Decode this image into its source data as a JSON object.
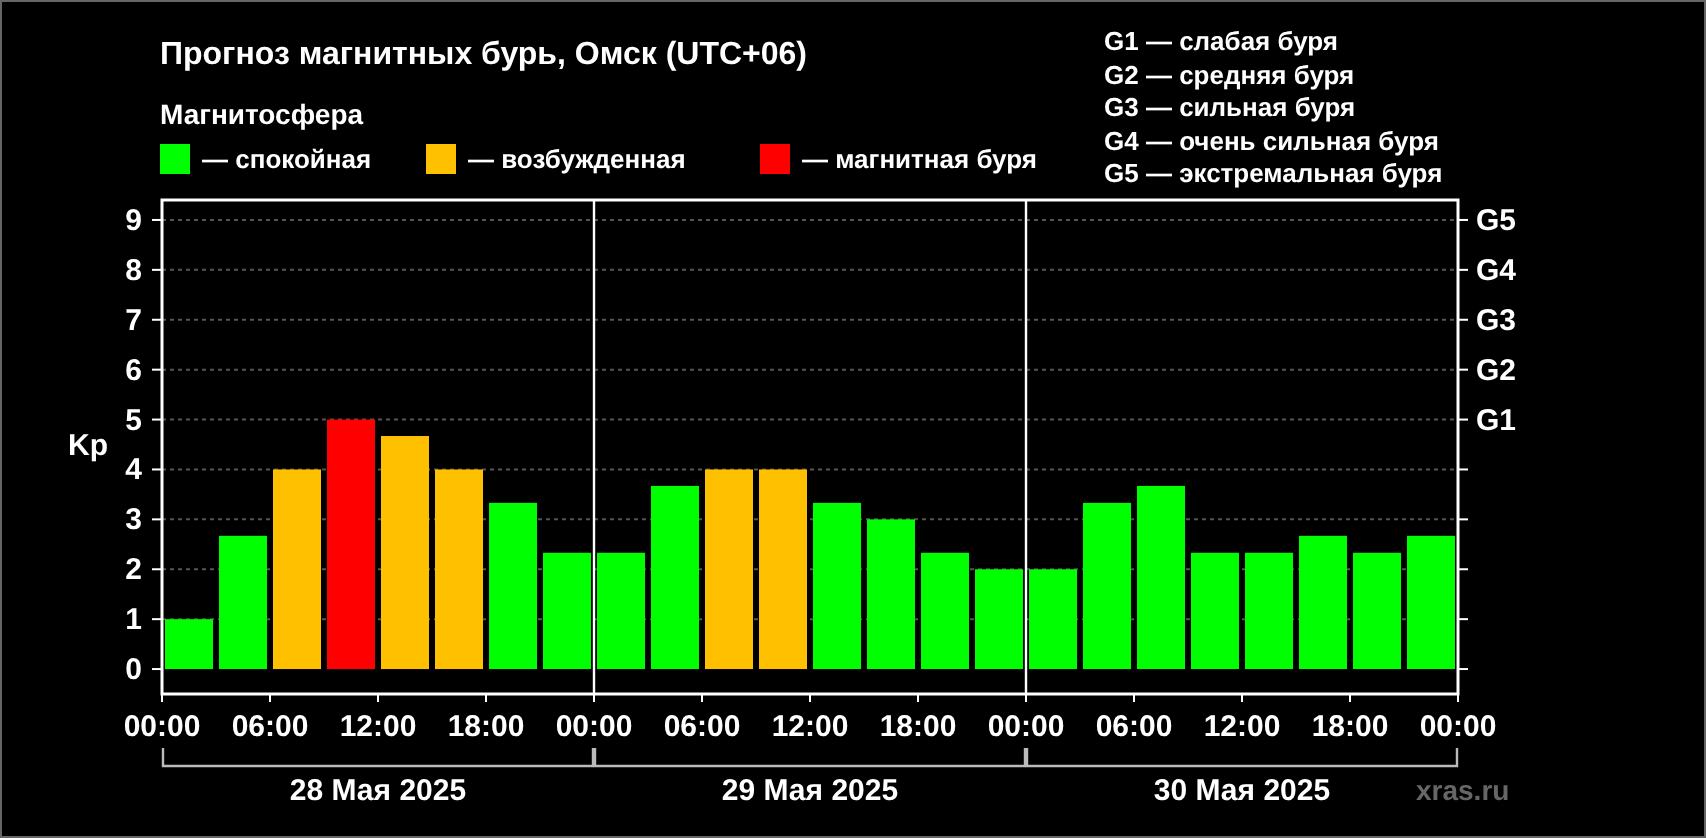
{
  "title": "Прогноз магнитных бурь, Омск (UTC+06)",
  "legend_title": "Магнитосфера",
  "legend_dash": "—",
  "storm_scale": [
    "G1 — слабая буря",
    "G2 — средняя буря",
    "G3 — сильная буря",
    "G4 — очень сильная буря",
    "G5 — экстремальная буря"
  ],
  "chart": {
    "chart_data": {
      "type": "bar",
      "ylabel": "Kp",
      "stacked": true,
      "grid": true,
      "ylim": [
        -0.5,
        9.4
      ],
      "yticks": [
        0,
        1,
        2,
        3,
        4,
        5,
        6,
        7,
        8,
        9
      ],
      "series": [
        {
          "name": "спокойная",
          "color": "#00ff00",
          "values": [
            1,
            2.67,
            null,
            null,
            null,
            null,
            3.33,
            2.33,
            2.33,
            3.67,
            null,
            null,
            3.33,
            3,
            2.33,
            2,
            2,
            3.33,
            3.67,
            2.33,
            2.33,
            2.67,
            2.33,
            2.67
          ]
        },
        {
          "name": "возбужденная",
          "color": "#ffc000",
          "values": [
            null,
            null,
            4,
            null,
            4.67,
            4,
            null,
            null,
            null,
            null,
            4,
            4,
            null,
            null,
            null,
            null,
            null,
            null,
            null,
            null,
            null,
            null,
            null,
            null
          ]
        },
        {
          "name": "магнитная буря",
          "color": "#ff0000",
          "values": [
            null,
            null,
            null,
            5,
            null,
            null,
            null,
            null,
            null,
            null,
            null,
            null,
            null,
            null,
            null,
            null,
            null,
            null,
            null,
            null,
            null,
            null,
            null,
            null
          ]
        }
      ]
    },
    "time_labels": [
      "00:00",
      "06:00",
      "12:00",
      "18:00",
      "00:00",
      "06:00",
      "12:00",
      "18:00",
      "00:00",
      "06:00",
      "12:00",
      "18:00",
      "00:00"
    ],
    "storm_levels": [
      "G5",
      "G4",
      "G3",
      "G2",
      "G1"
    ],
    "days": [
      "28 Мая 2025",
      "29 Мая 2025",
      "30 Мая 2025"
    ]
  },
  "credit": "xras.ru"
}
